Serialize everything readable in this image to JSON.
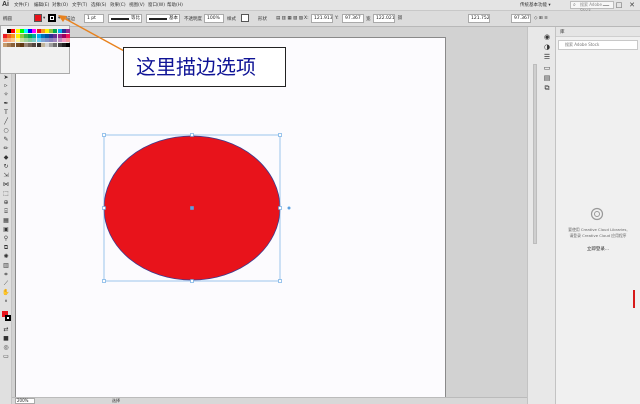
{
  "app": {
    "logo": "Ai",
    "workspace": "传统基本功能 ▾",
    "search_placeholder": "搜索 Adobe Stock"
  },
  "menu": [
    "文件(F)",
    "编辑(E)",
    "对象(O)",
    "文字(T)",
    "选择(S)",
    "效果(C)",
    "视图(V)",
    "窗口(W)",
    "帮助(H)"
  ],
  "window_controls": {
    "minimize": "—",
    "maximize": "□",
    "close": "✕"
  },
  "control_bar": {
    "selection_label": "椭圆",
    "fill_color": "#e8131b",
    "stroke_label": "描边",
    "stroke_weight": "1 pt",
    "profile_label": "等比",
    "brush_label": "基本",
    "opacity_label": "不透明度",
    "opacity_value": "100%",
    "style_label": "样式",
    "shape_label": "形状",
    "x_value": "121.913",
    "y_value": "97.367",
    "w_label": "宽",
    "w_value": "122.021",
    "h_value": "121.752",
    "angle_value": "97.367"
  },
  "callout": {
    "text": "这里描边选项",
    "text_color": "#0f1496",
    "arrow_color": "#e8821e"
  },
  "shape": {
    "type": "ellipse",
    "fill": "#e8131b",
    "stroke": "#3b3b8f",
    "selection_color": "#5aa0e0"
  },
  "right_panel": {
    "title": "库",
    "search_placeholder": "搜索 Adobe Stock",
    "cc_line1": "要使用 Creative Cloud Libraries,",
    "cc_line2": "请登录 Creative Cloud 应用程序",
    "sign_in": "立即登录..."
  },
  "status_bar": {
    "zoom": "200%",
    "tool": "选择"
  }
}
